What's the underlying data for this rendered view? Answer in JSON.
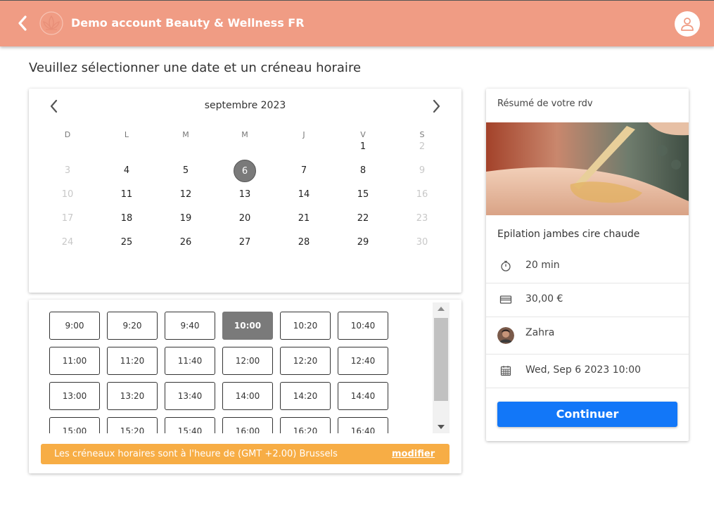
{
  "header": {
    "title": "Demo account Beauty & Wellness FR",
    "background": "#f09c84"
  },
  "page": {
    "heading": "Veuillez sélectionner une date et un créneau horaire"
  },
  "calendar": {
    "month_label": "septembre 2023",
    "weekdays": [
      "D",
      "L",
      "M",
      "M",
      "J",
      "V",
      "S"
    ],
    "weeks": [
      [
        null,
        null,
        null,
        null,
        null,
        "1",
        "2"
      ],
      [
        "3",
        "4",
        "5",
        "6",
        "7",
        "8",
        "9"
      ],
      [
        "10",
        "11",
        "12",
        "13",
        "14",
        "15",
        "16"
      ],
      [
        "17",
        "18",
        "19",
        "20",
        "21",
        "22",
        "23"
      ],
      [
        "24",
        "25",
        "26",
        "27",
        "28",
        "29",
        "30"
      ]
    ],
    "disabled_days": [
      "2",
      "3",
      "9",
      "10",
      "16",
      "17",
      "23",
      "24",
      "30"
    ],
    "selected_day": "6"
  },
  "slots": {
    "times": [
      [
        "9:00",
        "9:20",
        "9:40",
        "10:00",
        "10:20",
        "10:40"
      ],
      [
        "11:00",
        "11:20",
        "11:40",
        "12:00",
        "12:20",
        "12:40"
      ],
      [
        "13:00",
        "13:20",
        "13:40",
        "14:00",
        "14:20",
        "14:40"
      ],
      [
        "15:00",
        "15:20",
        "15:40",
        "16:00",
        "16:20",
        "16:40"
      ]
    ],
    "selected": "10:00",
    "timezone_note": "Les créneaux horaires sont à l'heure de (GMT +2.00) Brussels",
    "modify_link": "modifier",
    "note_color": "#f7ad45"
  },
  "summary": {
    "title": "Résumé de votre rdv",
    "service": "Epilation jambes cire chaude",
    "duration": "20 min",
    "price": "30,00 €",
    "staff": "Zahra",
    "datetime": "Wed, Sep 6 2023 10:00",
    "continue_label": "Continuer",
    "button_color": "#1277f8"
  },
  "icons": {
    "back": "chevron-left-icon",
    "logo": "lotus-logo-icon",
    "profile": "user-icon",
    "timer": "stopwatch-icon",
    "price": "credit-card-icon",
    "date": "calendar-icon"
  }
}
